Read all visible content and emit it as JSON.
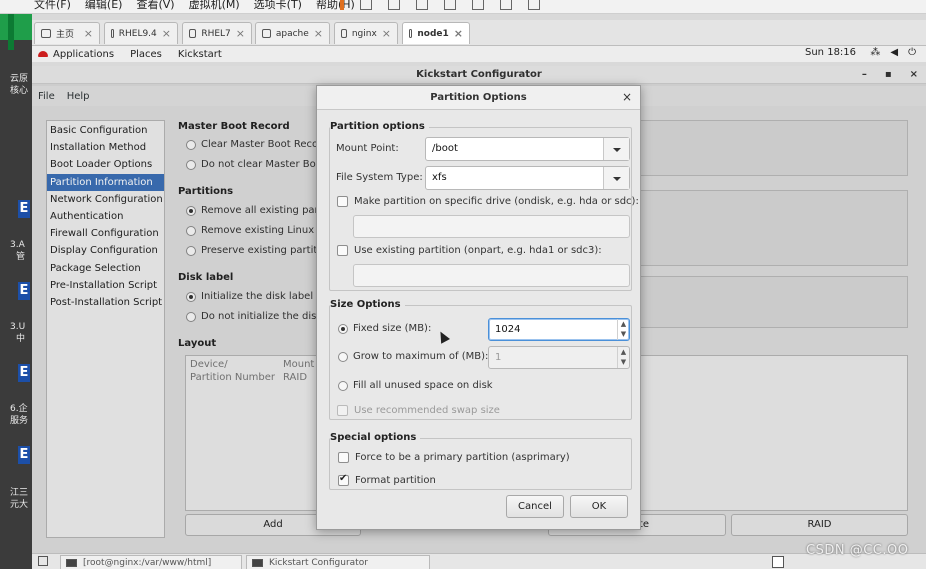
{
  "host": {
    "menu": [
      "文件(F)",
      "编辑(E)",
      "查看(V)",
      "虚拟机(M)",
      "选项卡(T)",
      "帮助(H)"
    ],
    "side_labels": [
      "云原",
      "核心",
      "3.A",
      "管",
      "3.U",
      "中",
      "6.企",
      "服务",
      "江三",
      "元大"
    ],
    "side_e": "E"
  },
  "tabs": [
    {
      "label": "主页",
      "icon": "home-icon"
    },
    {
      "label": "RHEL9.4",
      "icon": "vm-icon"
    },
    {
      "label": "RHEL7",
      "icon": "vm-icon"
    },
    {
      "label": "apache",
      "icon": "vm-icon"
    },
    {
      "label": "nginx",
      "icon": "vm-icon"
    },
    {
      "label": "node1",
      "icon": "vm-icon",
      "active": true
    }
  ],
  "gnome": {
    "applications": "Applications",
    "places": "Places",
    "kickstart": "Kickstart",
    "clock": "Sun 18:16"
  },
  "window": {
    "title": "Kickstart Configurator",
    "menu": {
      "file": "File",
      "help": "Help"
    },
    "nav": [
      "Basic Configuration",
      "Installation Method",
      "Boot Loader Options",
      "Partition Information",
      "Network Configuration",
      "Authentication",
      "Firewall Configuration",
      "Display Configuration",
      "Package Selection",
      "Pre-Installation Script",
      "Post-Installation Script"
    ],
    "nav_active_index": 3,
    "mbr": {
      "title": "Master Boot Record",
      "options": [
        "Clear Master Boot Record",
        "Do not clear Master Boot"
      ]
    },
    "partitions": {
      "title": "Partitions",
      "options": [
        "Remove all existing partiti",
        "Remove existing Linux part",
        "Preserve existing partition"
      ]
    },
    "disklabel": {
      "title": "Disk label",
      "options": [
        "Initialize the disk label",
        "Do not initialize the disk la"
      ]
    },
    "layout": {
      "title": "Layout",
      "col1_line1": "Device/",
      "col1_line2": "Partition Number",
      "col2_line1": "Mount P",
      "col2_line2": "RAID"
    },
    "buttons": {
      "add": "Add",
      "delete_partial": "te",
      "raid": "RAID"
    }
  },
  "dialog": {
    "title": "Partition Options",
    "close": "×",
    "partition_options": {
      "legend": "Partition options",
      "mount_point_label": "Mount Point:",
      "mount_point_value": "/boot",
      "fs_type_label": "File System Type:",
      "fs_type_value": "xfs",
      "specific_drive_label": "Make partition on specific drive (ondisk, e.g. hda or sdc):",
      "existing_partition_label": "Use existing partition (onpart, e.g. hda1 or sdc3):"
    },
    "size_options": {
      "legend": "Size Options",
      "fixed_label": "Fixed size (MB):",
      "fixed_value": "1024",
      "grow_label": "Grow to maximum of (MB):",
      "grow_value": "1",
      "fill_label": "Fill all unused space on disk",
      "swap_label": "Use recommended swap size"
    },
    "special_options": {
      "legend": "Special options",
      "primary_label": "Force to be a primary partition (asprimary)",
      "format_label": "Format partition"
    },
    "cancel": "Cancel",
    "ok": "OK"
  },
  "taskbar": {
    "terminal": "[root@nginx:/var/www/html]",
    "kickstart": "Kickstart Configurator"
  },
  "watermark": "CSDN @CC.OO"
}
